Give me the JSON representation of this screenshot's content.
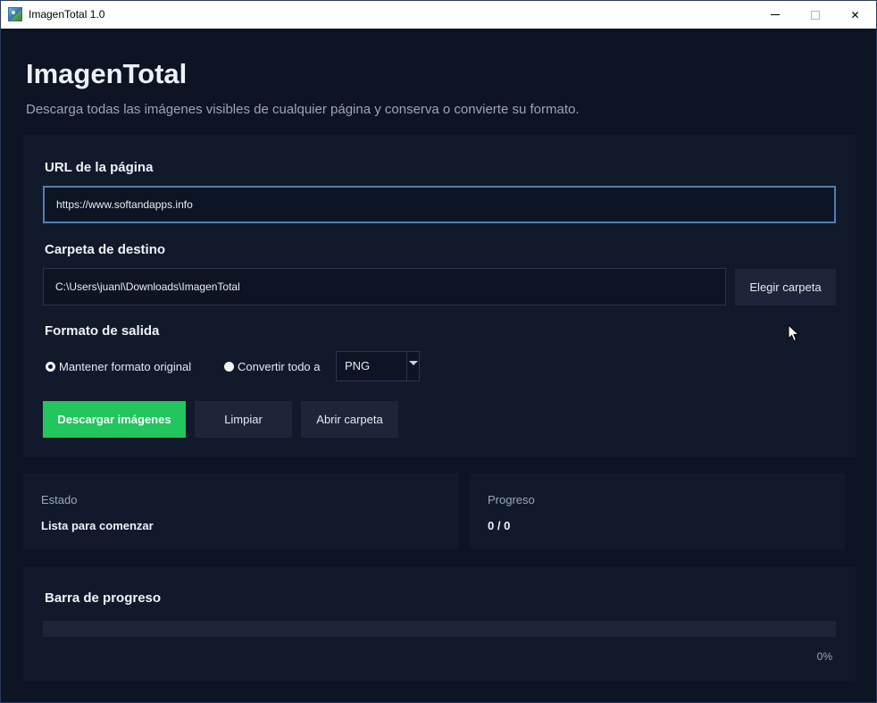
{
  "window": {
    "title": "ImagenTotal 1.0",
    "minimize_icon": "minimize-icon",
    "maximize_icon": "maximize-icon",
    "close_glyph": "✕"
  },
  "header": {
    "title": "ImagenTotal",
    "subtitle": "Descarga todas las imágenes visibles de cualquier página y conserva o convierte su formato."
  },
  "form": {
    "url_label": "URL de la página",
    "url_value": "https://www.softandapps.info",
    "folder_label": "Carpeta de destino",
    "folder_value": "C:\\Users\\juanl\\Downloads\\ImagenTotal",
    "choose_folder_label": "Elegir carpeta",
    "format_label": "Formato de salida",
    "keep_format_label": "Mantener formato original",
    "convert_label": "Convertir todo a",
    "convert_format": "PNG",
    "keep_format_selected": true
  },
  "actions": {
    "download_label": "Descargar imágenes",
    "clear_label": "Limpiar",
    "open_folder_label": "Abrir carpeta"
  },
  "status": {
    "state_label": "Estado",
    "state_value": "Lista para comenzar",
    "progress_label": "Progreso",
    "progress_value": "0 / 0"
  },
  "progress_bar": {
    "label": "Barra de progreso",
    "percent_text": "0%",
    "fraction": 0
  },
  "colors": {
    "accent": "#22c55e",
    "background": "#0d1424",
    "panel": "#111a2b",
    "focus_border": "#4f7fb5"
  }
}
